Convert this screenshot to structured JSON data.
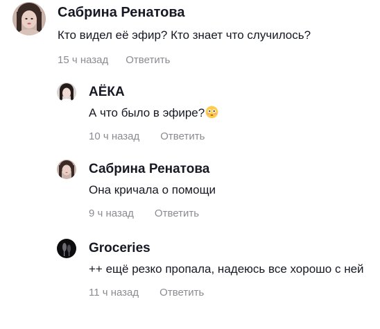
{
  "comments": [
    {
      "author": "Сабрина Ренатова",
      "text": "Кто видел её эфир? Кто знает что случилось?",
      "time": "15 ч назад",
      "reply_label": "Ответить",
      "avatar_icon": "user-avatar-photo"
    },
    {
      "author": "АЁКА",
      "text": "А что было в эфире?",
      "emoji": "flushed-face-emoji",
      "time": "10 ч назад",
      "reply_label": "Ответить",
      "avatar_icon": "user-avatar-photo"
    },
    {
      "author": "Сабрина Ренатова",
      "text": "Она кричала о помощи",
      "time": "9 ч назад",
      "reply_label": "Ответить",
      "avatar_icon": "user-avatar-photo"
    },
    {
      "author": "Groceries",
      "text": "++ ещё резко пропала, надеюсь все хорошо с ней",
      "time": "11 ч назад",
      "reply_label": "Ответить",
      "avatar_icon": "user-avatar-photo"
    }
  ],
  "colors": {
    "text": "#161823",
    "meta": "#8a8b91"
  }
}
